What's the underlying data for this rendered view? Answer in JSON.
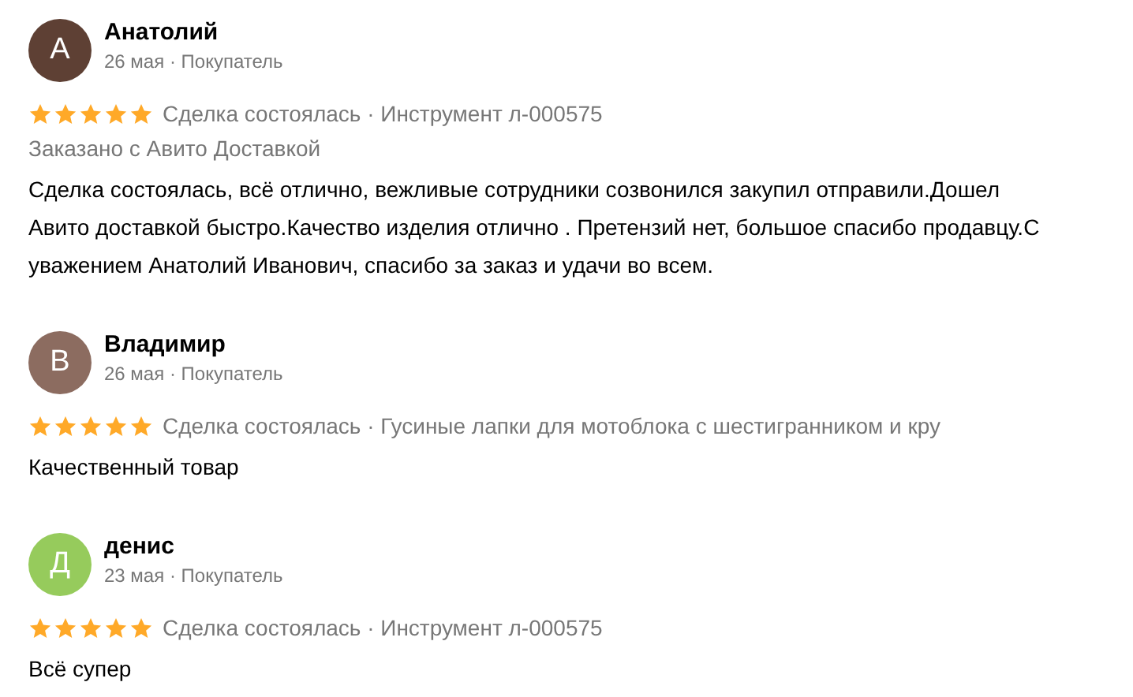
{
  "reviews": [
    {
      "avatar_letter": "А",
      "color": "#5e4034",
      "name": "Анатолий",
      "meta": "26 мая · Покупатель",
      "stars": 5,
      "deal": "Сделка состоялась · Инструмент л-000575",
      "delivery": "Заказано с Авито Доставкой",
      "text": "Сделка состоялась, всё отлично, вежливые сотрудники созвонился закупил отправили.Дошел Авито доставкой быстро.Качество изделия отлично . Претензий нет, большое спасибо продавцу.С уважением Анатолий Иванович, спасибо за заказ и удачи во всем."
    },
    {
      "avatar_letter": "В",
      "color": "#8c6c60",
      "name": "Владимир",
      "meta": "26 мая · Покупатель",
      "stars": 5,
      "deal": "Сделка состоялась · Гусиные лапки для мотоблока с шестигранником и кру",
      "text": "Качественный товар"
    },
    {
      "avatar_letter": "Д",
      "color": "#96cb5c",
      "name": "денис",
      "meta": "23 мая · Покупатель",
      "stars": 5,
      "deal": "Сделка состоялась · Инструмент л-000575",
      "text": "Всё супер"
    }
  ]
}
